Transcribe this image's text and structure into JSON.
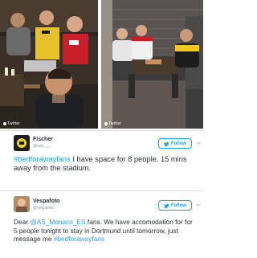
{
  "photos": {
    "left_watermark": "Twitter",
    "right_watermark": "Twitter"
  },
  "tweets": [
    {
      "display_name": "Fischer",
      "handle": "@sub___",
      "follow_label": "Follow",
      "text_hashtag": "#bedforawayfans",
      "text_body": " I have space for 8 people. 15 mins away from the stadium."
    },
    {
      "display_name": "Vespafoto",
      "handle": "@vespafoto",
      "follow_label": "Follow",
      "text_pre": "Dear ",
      "text_mention": "@AS_Monaco_ES",
      "text_body": " fans. We have accomodation for for 5 people tonight to stay in Dortmund until tomorrow, just message me ",
      "text_hashtag": "#bedforawayfans"
    }
  ],
  "colors": {
    "link": "#1da1f2",
    "text": "#292f33",
    "muted": "#8899a6",
    "border": "#d8dde1"
  }
}
